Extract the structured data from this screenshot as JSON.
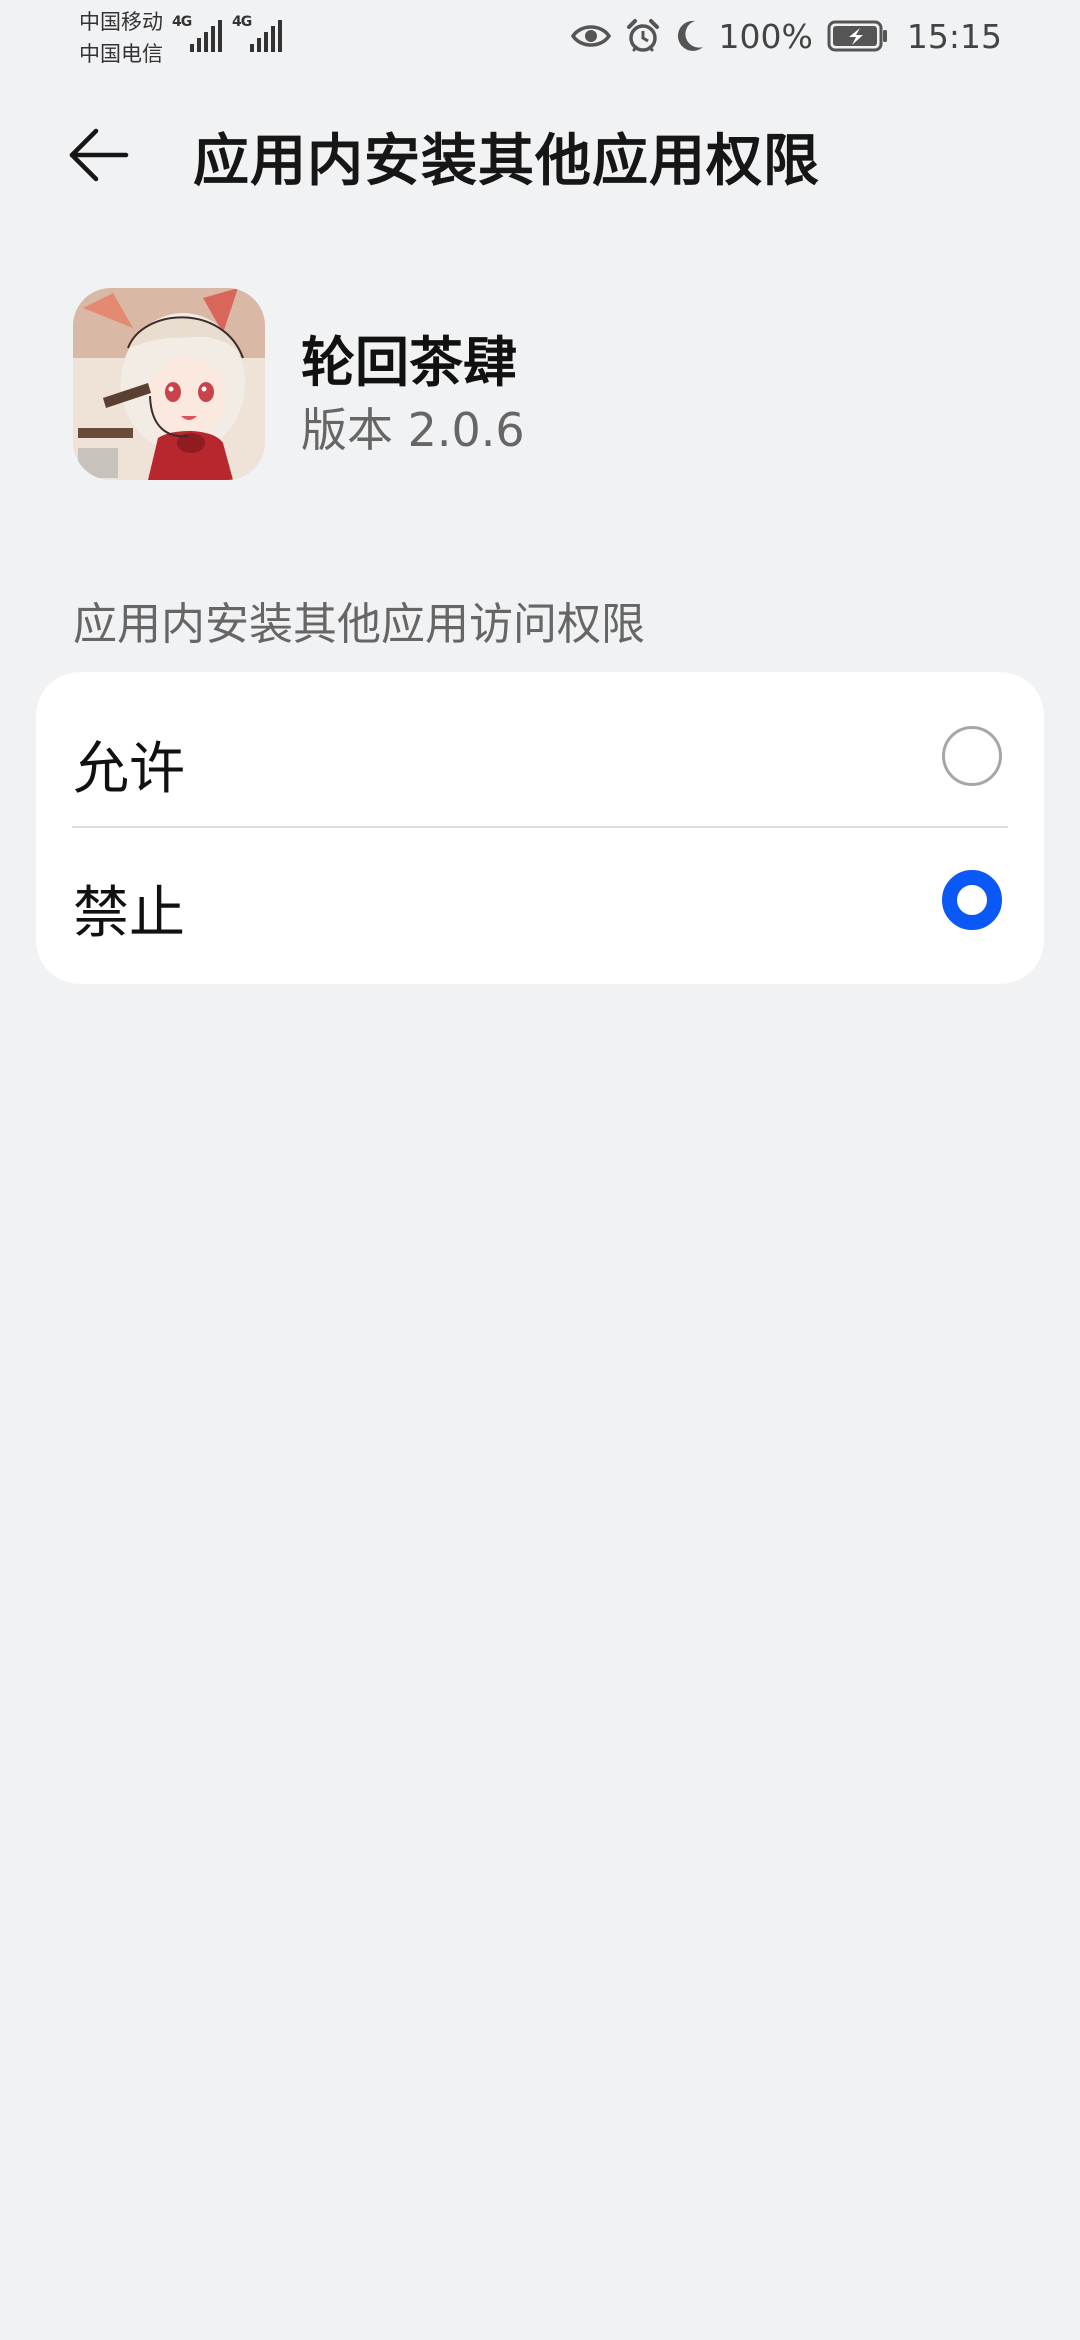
{
  "status_bar": {
    "carrier_1": "中国移动",
    "carrier_2": "中国电信",
    "network_1": "4G",
    "network_2": "4G",
    "icons": [
      "eye-comfort-icon",
      "alarm-icon",
      "do-not-disturb-moon-icon",
      "battery-charging-icon"
    ],
    "battery_percent": "100%",
    "time": "15:15"
  },
  "header": {
    "back_icon": "arrow-left-icon",
    "title": "应用内安装其他应用权限"
  },
  "app": {
    "name": "轮回茶肆",
    "version": "版本 2.0.6"
  },
  "section": {
    "title": "应用内安装其他应用访问权限",
    "options": [
      {
        "label": "允许",
        "selected": false
      },
      {
        "label": "禁止",
        "selected": true
      }
    ]
  },
  "colors": {
    "background": "#f1f2f4",
    "card": "#ffffff",
    "accent": "#0a59f7",
    "radio_off": "#a6a6a6"
  }
}
